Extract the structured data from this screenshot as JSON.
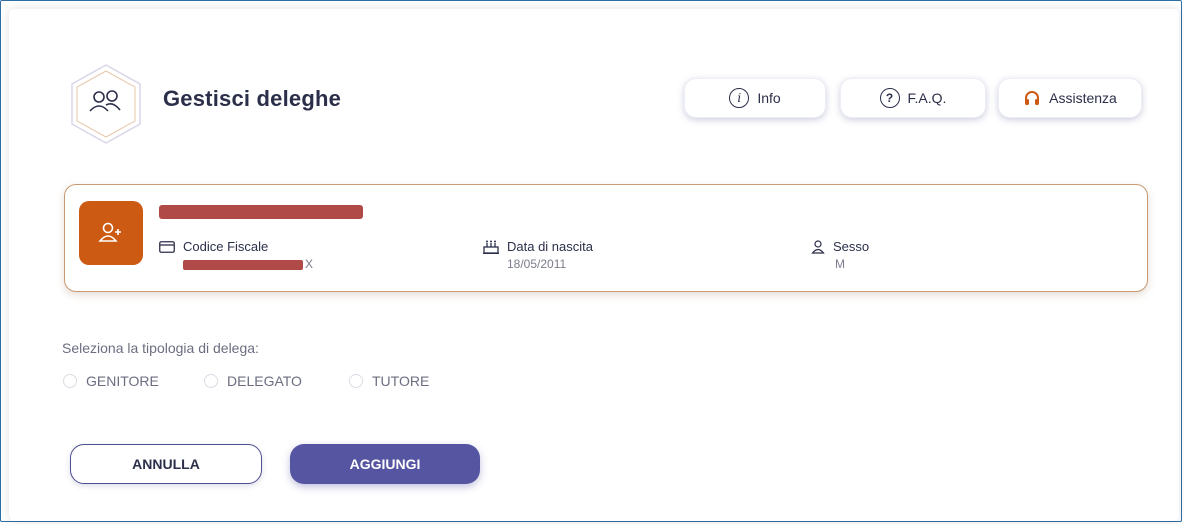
{
  "header": {
    "title": "Gestisci deleghe",
    "buttons": {
      "info": "Info",
      "faq": "F.A.Q.",
      "assist": "Assistenza"
    }
  },
  "person": {
    "cf_label": "Codice Fiscale",
    "cf_value_suffix": "X",
    "dob_label": "Data di nascita",
    "dob_value": "18/05/2011",
    "sex_label": "Sesso",
    "sex_value": "M"
  },
  "delega": {
    "prompt": "Seleziona la tipologia di delega:",
    "options": [
      "GENITORE",
      "DELEGATO",
      "TUTORE"
    ]
  },
  "actions": {
    "cancel": "ANNULLA",
    "add": "AGGIUNGI"
  },
  "colors": {
    "accent": "#5655a2",
    "orange": "#cc5a13",
    "card_border": "#c89a72"
  }
}
